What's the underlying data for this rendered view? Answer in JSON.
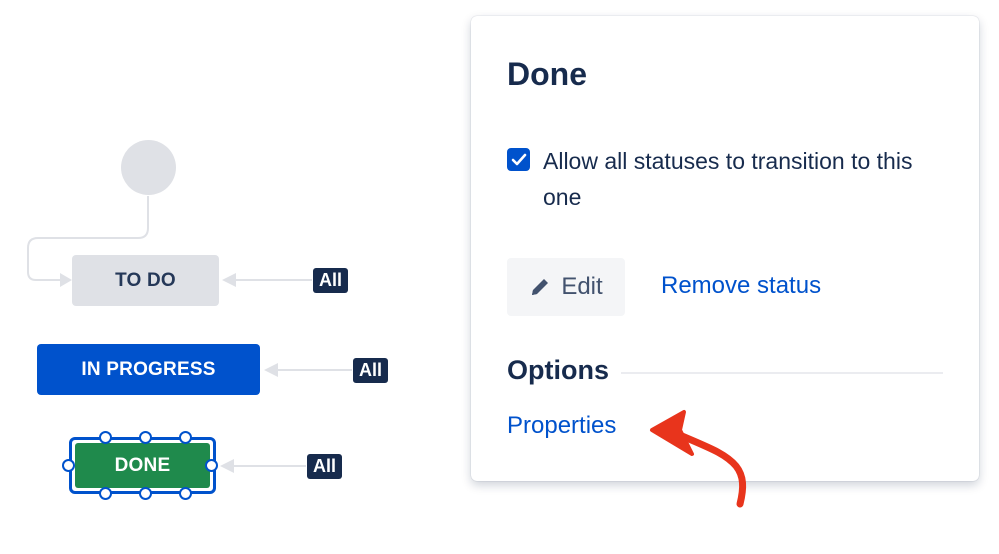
{
  "diagram": {
    "statuses": [
      {
        "label": "TO DO"
      },
      {
        "label": "IN PROGRESS"
      },
      {
        "label": "DONE"
      }
    ],
    "transition_badges": [
      "All",
      "All",
      "All"
    ],
    "colors": {
      "todo": "#dfe1e6",
      "in_progress": "#0052cc",
      "done": "#1f8a4c",
      "selection": "#0052cc"
    }
  },
  "panel": {
    "title": "Done",
    "allow_all_checkbox": {
      "checked": true,
      "label": "Allow all statuses to transition to this one"
    },
    "edit_button": {
      "label": "Edit",
      "icon": "pencil-icon"
    },
    "remove_status_link": "Remove status",
    "options_heading": "Options",
    "properties_link": "Properties"
  },
  "annotation": {
    "type": "arrow",
    "color": "#e8341c"
  }
}
